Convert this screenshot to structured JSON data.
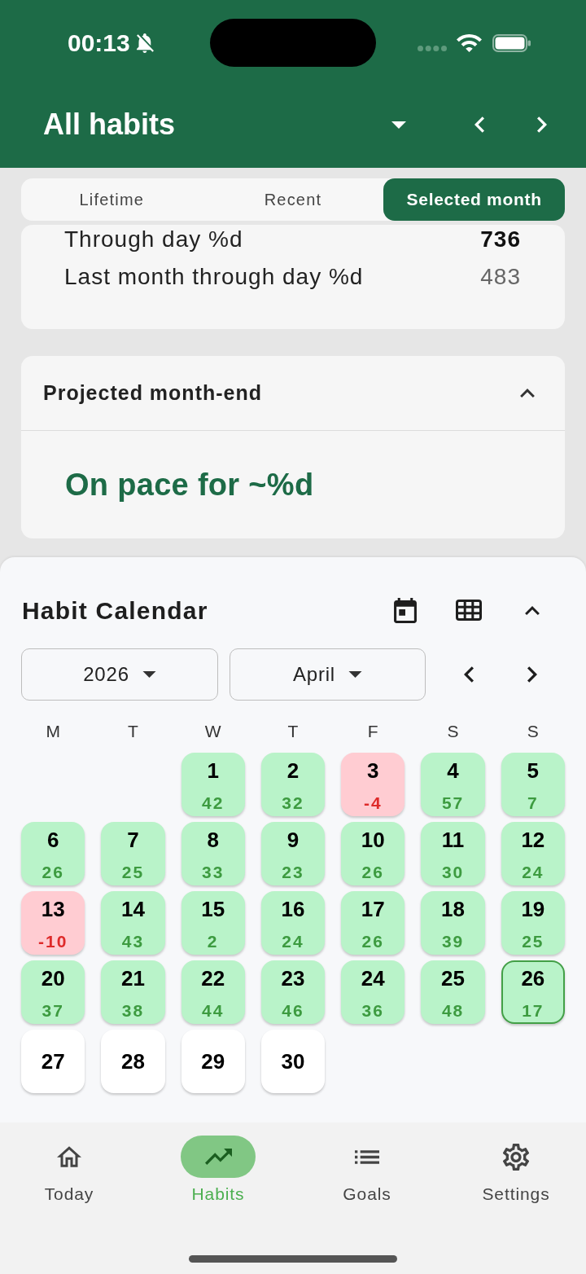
{
  "status_bar": {
    "time": "00:13"
  },
  "header": {
    "title": "All habits"
  },
  "tabs": [
    {
      "label": "Lifetime",
      "selected": false
    },
    {
      "label": "Recent",
      "selected": false
    },
    {
      "label": "Selected month",
      "selected": true
    }
  ],
  "month_stats": [
    {
      "label": "Through day %d",
      "value": "736",
      "bold": true
    },
    {
      "label": "Last month through day %d",
      "value": "483",
      "bold": false
    }
  ],
  "projection": {
    "title": "Projected month-end",
    "expanded": true,
    "text": "On pace for ~%d"
  },
  "calendar": {
    "title": "Habit Calendar",
    "expanded": true,
    "year": "2026",
    "month": "April",
    "weekdays": [
      "M",
      "T",
      "W",
      "T",
      "F",
      "S",
      "S"
    ],
    "weeks": [
      [
        {
          "day": "1",
          "value": "42",
          "kind": "good",
          "selected": false
        },
        {
          "day": "2",
          "value": "32",
          "kind": "good",
          "selected": false
        },
        {
          "day": "3",
          "value": "-4",
          "kind": "bad",
          "selected": false
        },
        {
          "day": "4",
          "value": "57",
          "kind": "good",
          "selected": false
        },
        {
          "day": "5",
          "value": "7",
          "kind": "good",
          "selected": false
        }
      ],
      [
        {
          "day": "6",
          "value": "26",
          "kind": "good",
          "selected": false
        },
        {
          "day": "7",
          "value": "25",
          "kind": "good",
          "selected": false
        },
        {
          "day": "8",
          "value": "33",
          "kind": "good",
          "selected": false
        },
        {
          "day": "9",
          "value": "23",
          "kind": "good",
          "selected": false
        },
        {
          "day": "10",
          "value": "26",
          "kind": "good",
          "selected": false
        },
        {
          "day": "11",
          "value": "30",
          "kind": "good",
          "selected": false
        },
        {
          "day": "12",
          "value": "24",
          "kind": "good",
          "selected": false
        }
      ],
      [
        {
          "day": "13",
          "value": "-10",
          "kind": "bad",
          "selected": false
        },
        {
          "day": "14",
          "value": "43",
          "kind": "good",
          "selected": false
        },
        {
          "day": "15",
          "value": "2",
          "kind": "good",
          "selected": false
        },
        {
          "day": "16",
          "value": "24",
          "kind": "good",
          "selected": false
        },
        {
          "day": "17",
          "value": "26",
          "kind": "good",
          "selected": false
        },
        {
          "day": "18",
          "value": "39",
          "kind": "good",
          "selected": false
        },
        {
          "day": "19",
          "value": "25",
          "kind": "good",
          "selected": false
        }
      ],
      [
        {
          "day": "20",
          "value": "37",
          "kind": "good",
          "selected": false
        },
        {
          "day": "21",
          "value": "38",
          "kind": "good",
          "selected": false
        },
        {
          "day": "22",
          "value": "44",
          "kind": "good",
          "selected": false
        },
        {
          "day": "23",
          "value": "46",
          "kind": "good",
          "selected": false
        },
        {
          "day": "24",
          "value": "36",
          "kind": "good",
          "selected": false
        },
        {
          "day": "25",
          "value": "48",
          "kind": "good",
          "selected": false
        },
        {
          "day": "26",
          "value": "17",
          "kind": "good",
          "selected": true
        }
      ],
      [
        {
          "day": "27",
          "kind": "future",
          "selected": false
        },
        {
          "day": "28",
          "kind": "future",
          "selected": false
        },
        {
          "day": "29",
          "kind": "future",
          "selected": false
        },
        {
          "day": "30",
          "kind": "future",
          "selected": false
        }
      ]
    ]
  },
  "bottom_nav": [
    {
      "label": "Today",
      "selected": false
    },
    {
      "label": "Habits",
      "selected": true
    },
    {
      "label": "Goals",
      "selected": false
    },
    {
      "label": "Settings",
      "selected": false
    }
  ]
}
